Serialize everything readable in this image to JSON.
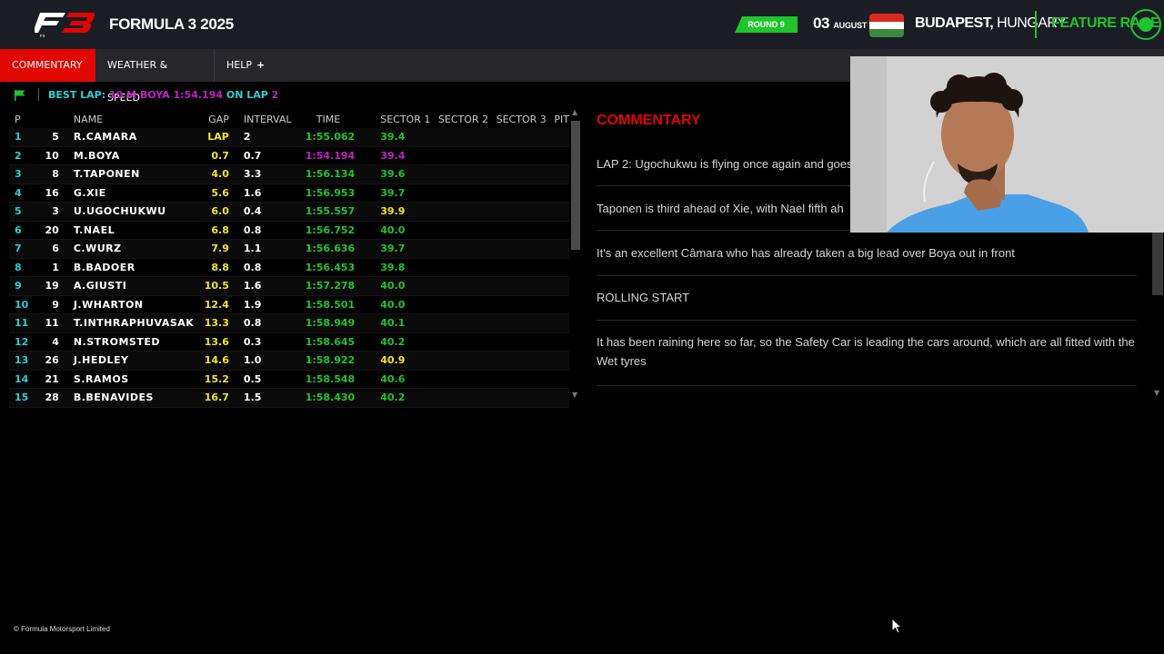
{
  "header": {
    "logo_text": "F3",
    "series": "FORMULA 3 2025",
    "round": "ROUND 9",
    "day": "03",
    "month": "AUGUST",
    "city": "BUDAPEST,",
    "country": "HUNGARY",
    "session": "FEATURE RACE"
  },
  "nav": {
    "tabs": [
      {
        "label": "COMMENTARY",
        "active": true
      },
      {
        "label": "WEATHER & SPEED",
        "active": false
      },
      {
        "label": "HELP",
        "active": false
      }
    ],
    "help_plus": "+"
  },
  "best_lap": {
    "prefix": "BEST LAP:",
    "driver": "10 M BOYA 1:54.194",
    "on": "ON LAP",
    "lap": "2"
  },
  "timing": {
    "columns": [
      "P",
      "",
      "NAME",
      "GAP",
      "INTERVAL",
      "TIME",
      "SECTOR 1",
      "SECTOR 2",
      "SECTOR 3",
      "PIT"
    ],
    "rows": [
      {
        "p": "1",
        "num": "5",
        "name": "R.CAMARA",
        "gap": "LAP",
        "interval": "2",
        "time": "1:55.062",
        "s1": "39.4",
        "time_pb": false,
        "s1_style": "green"
      },
      {
        "p": "2",
        "num": "10",
        "name": "M.BOYA",
        "gap": "0.7",
        "interval": "0.7",
        "time": "1:54.194",
        "s1": "39.4",
        "time_pb": true,
        "s1_style": "purple"
      },
      {
        "p": "3",
        "num": "8",
        "name": "T.TAPONEN",
        "gap": "4.0",
        "interval": "3.3",
        "time": "1:56.134",
        "s1": "39.6",
        "time_pb": false,
        "s1_style": "green"
      },
      {
        "p": "4",
        "num": "16",
        "name": "G.XIE",
        "gap": "5.6",
        "interval": "1.6",
        "time": "1:56.953",
        "s1": "39.7",
        "time_pb": false,
        "s1_style": "green"
      },
      {
        "p": "5",
        "num": "3",
        "name": "U.UGOCHUKWU",
        "gap": "6.0",
        "interval": "0.4",
        "time": "1:55.557",
        "s1": "39.9",
        "time_pb": false,
        "s1_style": "yellow"
      },
      {
        "p": "6",
        "num": "20",
        "name": "T.NAEL",
        "gap": "6.8",
        "interval": "0.8",
        "time": "1:56.752",
        "s1": "40.0",
        "time_pb": false,
        "s1_style": "green"
      },
      {
        "p": "7",
        "num": "6",
        "name": "C.WURZ",
        "gap": "7.9",
        "interval": "1.1",
        "time": "1:56.636",
        "s1": "39.7",
        "time_pb": false,
        "s1_style": "green"
      },
      {
        "p": "8",
        "num": "1",
        "name": "B.BADOER",
        "gap": "8.8",
        "interval": "0.8",
        "time": "1:56.453",
        "s1": "39.8",
        "time_pb": false,
        "s1_style": "green"
      },
      {
        "p": "9",
        "num": "19",
        "name": "A.GIUSTI",
        "gap": "10.5",
        "interval": "1.6",
        "time": "1:57.278",
        "s1": "40.0",
        "time_pb": false,
        "s1_style": "green"
      },
      {
        "p": "10",
        "num": "9",
        "name": "J.WHARTON",
        "gap": "12.4",
        "interval": "1.9",
        "time": "1:58.501",
        "s1": "40.0",
        "time_pb": false,
        "s1_style": "green"
      },
      {
        "p": "11",
        "num": "11",
        "name": "T.INTHRAPHUVASAK",
        "gap": "13.3",
        "interval": "0.8",
        "time": "1:58.949",
        "s1": "40.1",
        "time_pb": false,
        "s1_style": "green"
      },
      {
        "p": "12",
        "num": "4",
        "name": "N.STROMSTED",
        "gap": "13.6",
        "interval": "0.3",
        "time": "1:58.645",
        "s1": "40.2",
        "time_pb": false,
        "s1_style": "green"
      },
      {
        "p": "13",
        "num": "26",
        "name": "J.HEDLEY",
        "gap": "14.6",
        "interval": "1.0",
        "time": "1:58.922",
        "s1": "40.9",
        "time_pb": false,
        "s1_style": "yellow"
      },
      {
        "p": "14",
        "num": "21",
        "name": "S.RAMOS",
        "gap": "15.2",
        "interval": "0.5",
        "time": "1:58.548",
        "s1": "40.6",
        "time_pb": false,
        "s1_style": "green"
      },
      {
        "p": "15",
        "num": "28",
        "name": "B.BENAVIDES",
        "gap": "16.7",
        "interval": "1.5",
        "time": "1:58.430",
        "s1": "40.2",
        "time_pb": false,
        "s1_style": "green"
      }
    ]
  },
  "commentary": {
    "title": "COMMENTARY",
    "items": [
      "LAP 2: Ugochukwu is flying once again and goes",
      "Taponen is third ahead of Xie, with Nael fifth ah",
      "It's an excellent Câmara who has already taken a big lead over Boya out in front",
      "ROLLING START",
      "It has been raining here so far, so the Safety Car is leading the cars around, which are all fitted with the Wet tyres"
    ]
  },
  "footer": {
    "copyright": "© Formula Motorsport Limited"
  },
  "colors": {
    "accent_red": "#e10600",
    "green": "#1fc42f",
    "purple": "#c021c6",
    "yellow": "#f2e629",
    "cyan": "#29d0d4"
  }
}
